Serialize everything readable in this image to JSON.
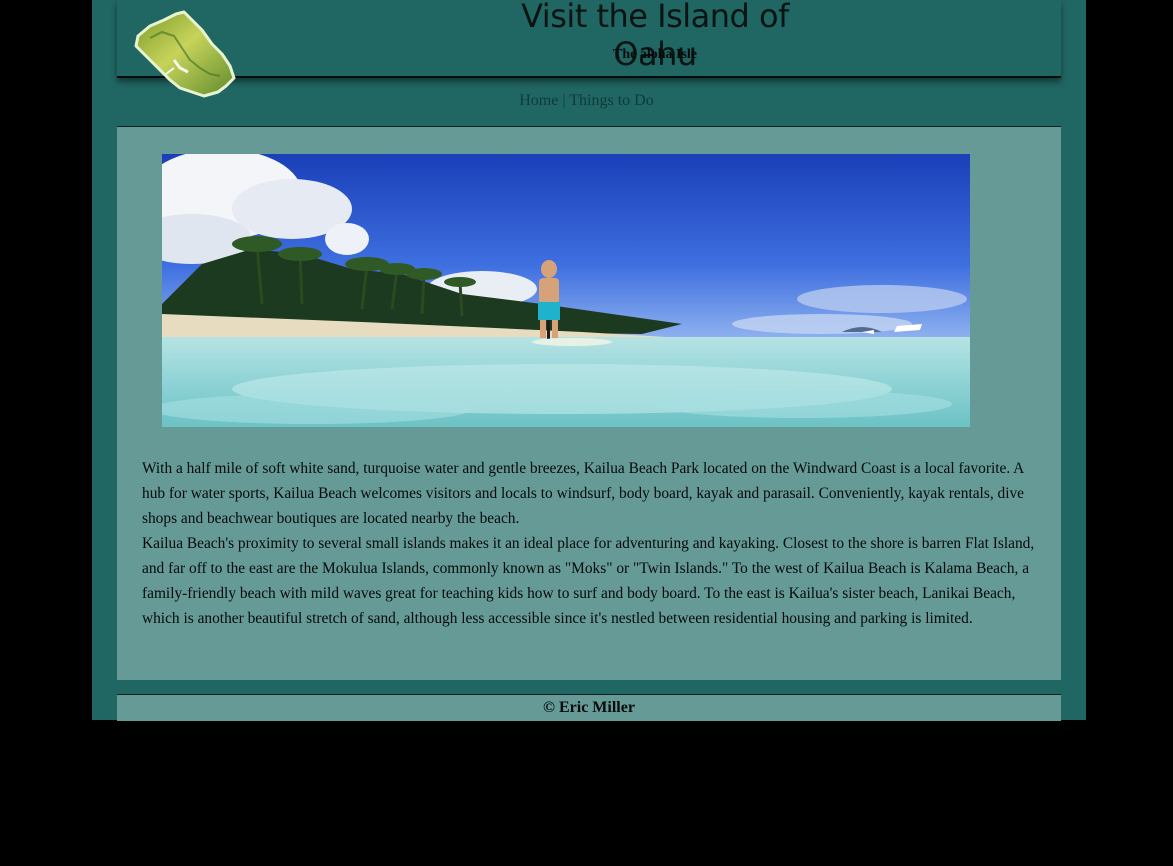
{
  "header": {
    "title": "Visit the Island of Oahu",
    "tagline": "The aloha Isle",
    "logo_icon": "oahu-island-map-icon"
  },
  "nav": {
    "items": [
      {
        "label": "Home"
      },
      {
        "label": "Things to Do"
      }
    ],
    "separator": "|"
  },
  "hero": {
    "image_icon": "kailua-beach-paddleboarder-photo"
  },
  "article": {
    "paragraphs": [
      "With a half mile of soft white sand, turquoise water and gentle breezes, Kailua Beach Park located on the Windward Coast is a local favorite. A hub for water sports, Kailua Beach welcomes visitors and locals to windsurf, body board, kayak and parasail. Conveniently, kayak rentals, dive shops and beachwear boutiques are located nearby the beach.",
      "Kailua Beach's proximity to several small islands makes it an ideal place for adventuring and kayaking. Closest to the shore is barren Flat Island, and far off to the east are the Mokulua Islands, commonly known as \"Moks\" or \"Twin Islands.\" To the west of Kailua Beach is Kalama Beach, a family-friendly beach with mild waves great for teaching kids how to surf and body board. To the east is Kailua's sister beach, Lanikai Beach, which is another beautiful stretch of sand, although less accessible since it's nestled between residential housing and parking is limited."
    ]
  },
  "footer": {
    "copyright": "© Eric Miller"
  },
  "colors": {
    "page_background": "#000000",
    "frame": "#206763",
    "content_panel": "#669a97",
    "nav_link": "#0e3a3a"
  }
}
